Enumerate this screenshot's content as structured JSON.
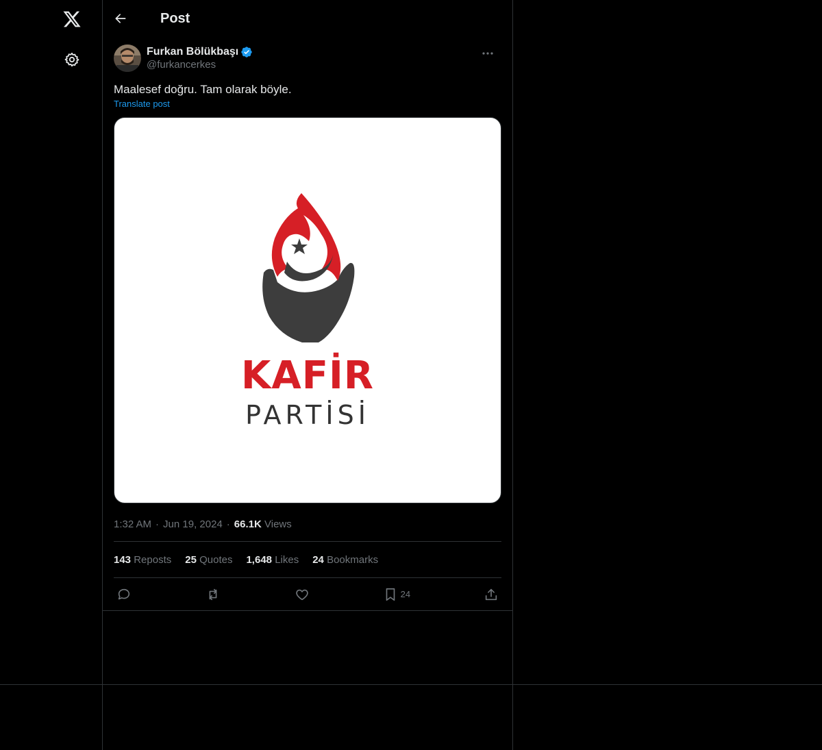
{
  "header": {
    "title": "Post"
  },
  "nav": {
    "logo_icon": "x-logo-icon",
    "settings_icon": "gear-icon"
  },
  "post": {
    "author_name": "Furkan Bölükbaşı",
    "author_handle": "@furkancerkes",
    "text": "Maalesef doğru. Tam olarak böyle.",
    "translate_label": "Translate post",
    "media": {
      "logo_title": "KAFİR",
      "logo_subtitle": "PARTİSİ"
    },
    "time": "1:32 AM",
    "date": "Jun 19, 2024",
    "views_count": "66.1K",
    "views_label": "Views",
    "stats": {
      "reposts_count": "143",
      "reposts_label": "Reposts",
      "quotes_count": "25",
      "quotes_label": "Quotes",
      "likes_count": "1,648",
      "likes_label": "Likes",
      "bookmarks_count": "24",
      "bookmarks_label": "Bookmarks"
    },
    "actions": {
      "bookmark_count": "24"
    }
  },
  "colors": {
    "background": "#000000",
    "text": "#e7e9ea",
    "muted": "#71767b",
    "accent": "#1d9bf0",
    "border": "#2f3336",
    "logo_red": "#d61f26",
    "logo_dark": "#3d3d3d"
  }
}
